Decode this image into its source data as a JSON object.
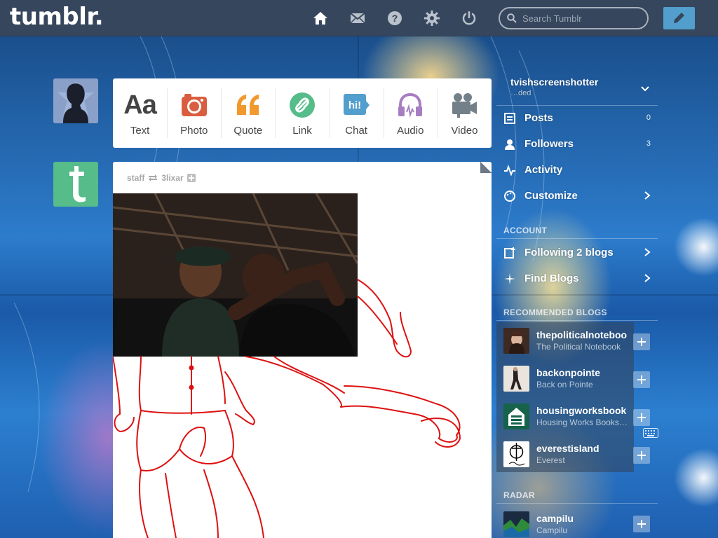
{
  "topbar": {
    "logo": "tumblr.",
    "search_placeholder": "Search Tumblr",
    "icons": [
      "home-icon",
      "inbox-icon",
      "help-icon",
      "settings-icon",
      "logout-icon",
      "compose-pencil-icon"
    ]
  },
  "post_types": [
    {
      "label": "Text",
      "icon": "text-aa-icon",
      "color": "#444444"
    },
    {
      "label": "Photo",
      "icon": "camera-icon",
      "color": "#d95e40"
    },
    {
      "label": "Quote",
      "icon": "quote-icon",
      "color": "#f2992e"
    },
    {
      "label": "Link",
      "icon": "link-icon",
      "color": "#56bc8a"
    },
    {
      "label": "Chat",
      "icon": "chat-icon",
      "color": "#529ecc"
    },
    {
      "label": "Audio",
      "icon": "headphones-icon",
      "color": "#a77dc2"
    },
    {
      "label": "Video",
      "icon": "video-camera-icon",
      "color": "#748089"
    }
  ],
  "post": {
    "author": "staff",
    "reblogged_from": "3lixar"
  },
  "sidebar": {
    "blog": {
      "name": "tvishscreenshotter",
      "title": "…ded"
    },
    "items": [
      {
        "label": "Posts",
        "count": "0"
      },
      {
        "label": "Followers",
        "count": "3"
      },
      {
        "label": "Activity"
      },
      {
        "label": "Customize"
      }
    ],
    "account_header": "ACCOUNT",
    "account_items": [
      {
        "label": "Following 2 blogs"
      },
      {
        "label": "Find Blogs"
      }
    ],
    "recommended_header": "RECOMMENDED BLOGS",
    "recommended": [
      {
        "name": "thepoliticalnoteboo",
        "title": "The Political Notebook"
      },
      {
        "name": "backonpointe",
        "title": "Back on Pointe"
      },
      {
        "name": "housingworksbook",
        "title": "Housing Works Books…"
      },
      {
        "name": "everestisland",
        "title": "Everest"
      }
    ],
    "radar_header": "RADAR",
    "radar_item": {
      "name": "campilu",
      "title": "Campilu"
    }
  },
  "colors": {
    "topbar": "#36465d",
    "compose": "#529ecc",
    "drawing": "#dd1111"
  }
}
